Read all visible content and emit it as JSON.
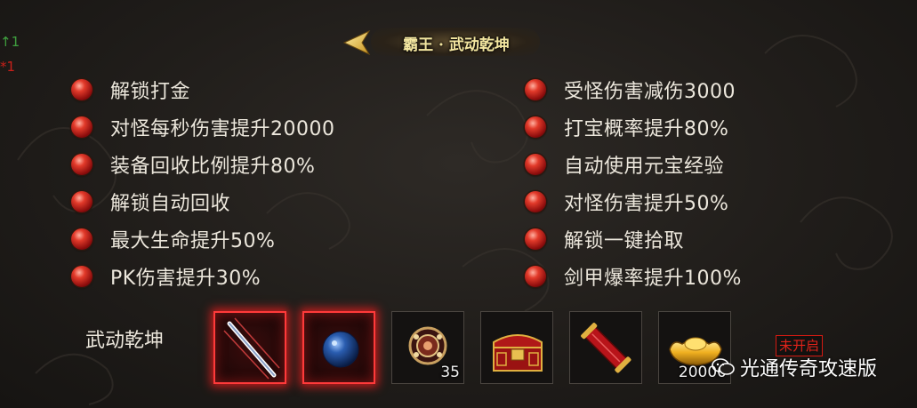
{
  "side_marks": [
    "1",
    "1"
  ],
  "title": "霸王 · 武动乾坤",
  "left_benefits": [
    "解锁打金",
    "对怪每秒伤害提升20000",
    "装备回收比例提升80%",
    "解锁自动回收",
    "最大生命提升50%",
    "PK伤害提升30%"
  ],
  "right_benefits": [
    "受怪伤害减伤3000",
    "打宝概率提升80%",
    "自动使用元宝经验",
    "对怪伤害提升50%",
    "解锁一键拾取",
    "剑甲爆率提升100%"
  ],
  "rewards_label": "武动乾坤",
  "rewards": [
    {
      "icon": "sword-icon",
      "count": "",
      "highlighted": true
    },
    {
      "icon": "blue-orb-icon",
      "count": "",
      "highlighted": true
    },
    {
      "icon": "gem-ring-icon",
      "count": "35",
      "highlighted": false
    },
    {
      "icon": "treasure-chest-icon",
      "count": "",
      "highlighted": false
    },
    {
      "icon": "scroll-icon",
      "count": "",
      "highlighted": false
    },
    {
      "icon": "gold-ingot-icon",
      "count": "20000",
      "highlighted": false
    }
  ],
  "status_badge": "未开启",
  "watermark": "光通传奇攻速版",
  "colors": {
    "benefit_dot": "#c21a14",
    "highlight_border": "#ff3a3a",
    "badge": "#e0231a",
    "title": "#f3e6a0"
  }
}
